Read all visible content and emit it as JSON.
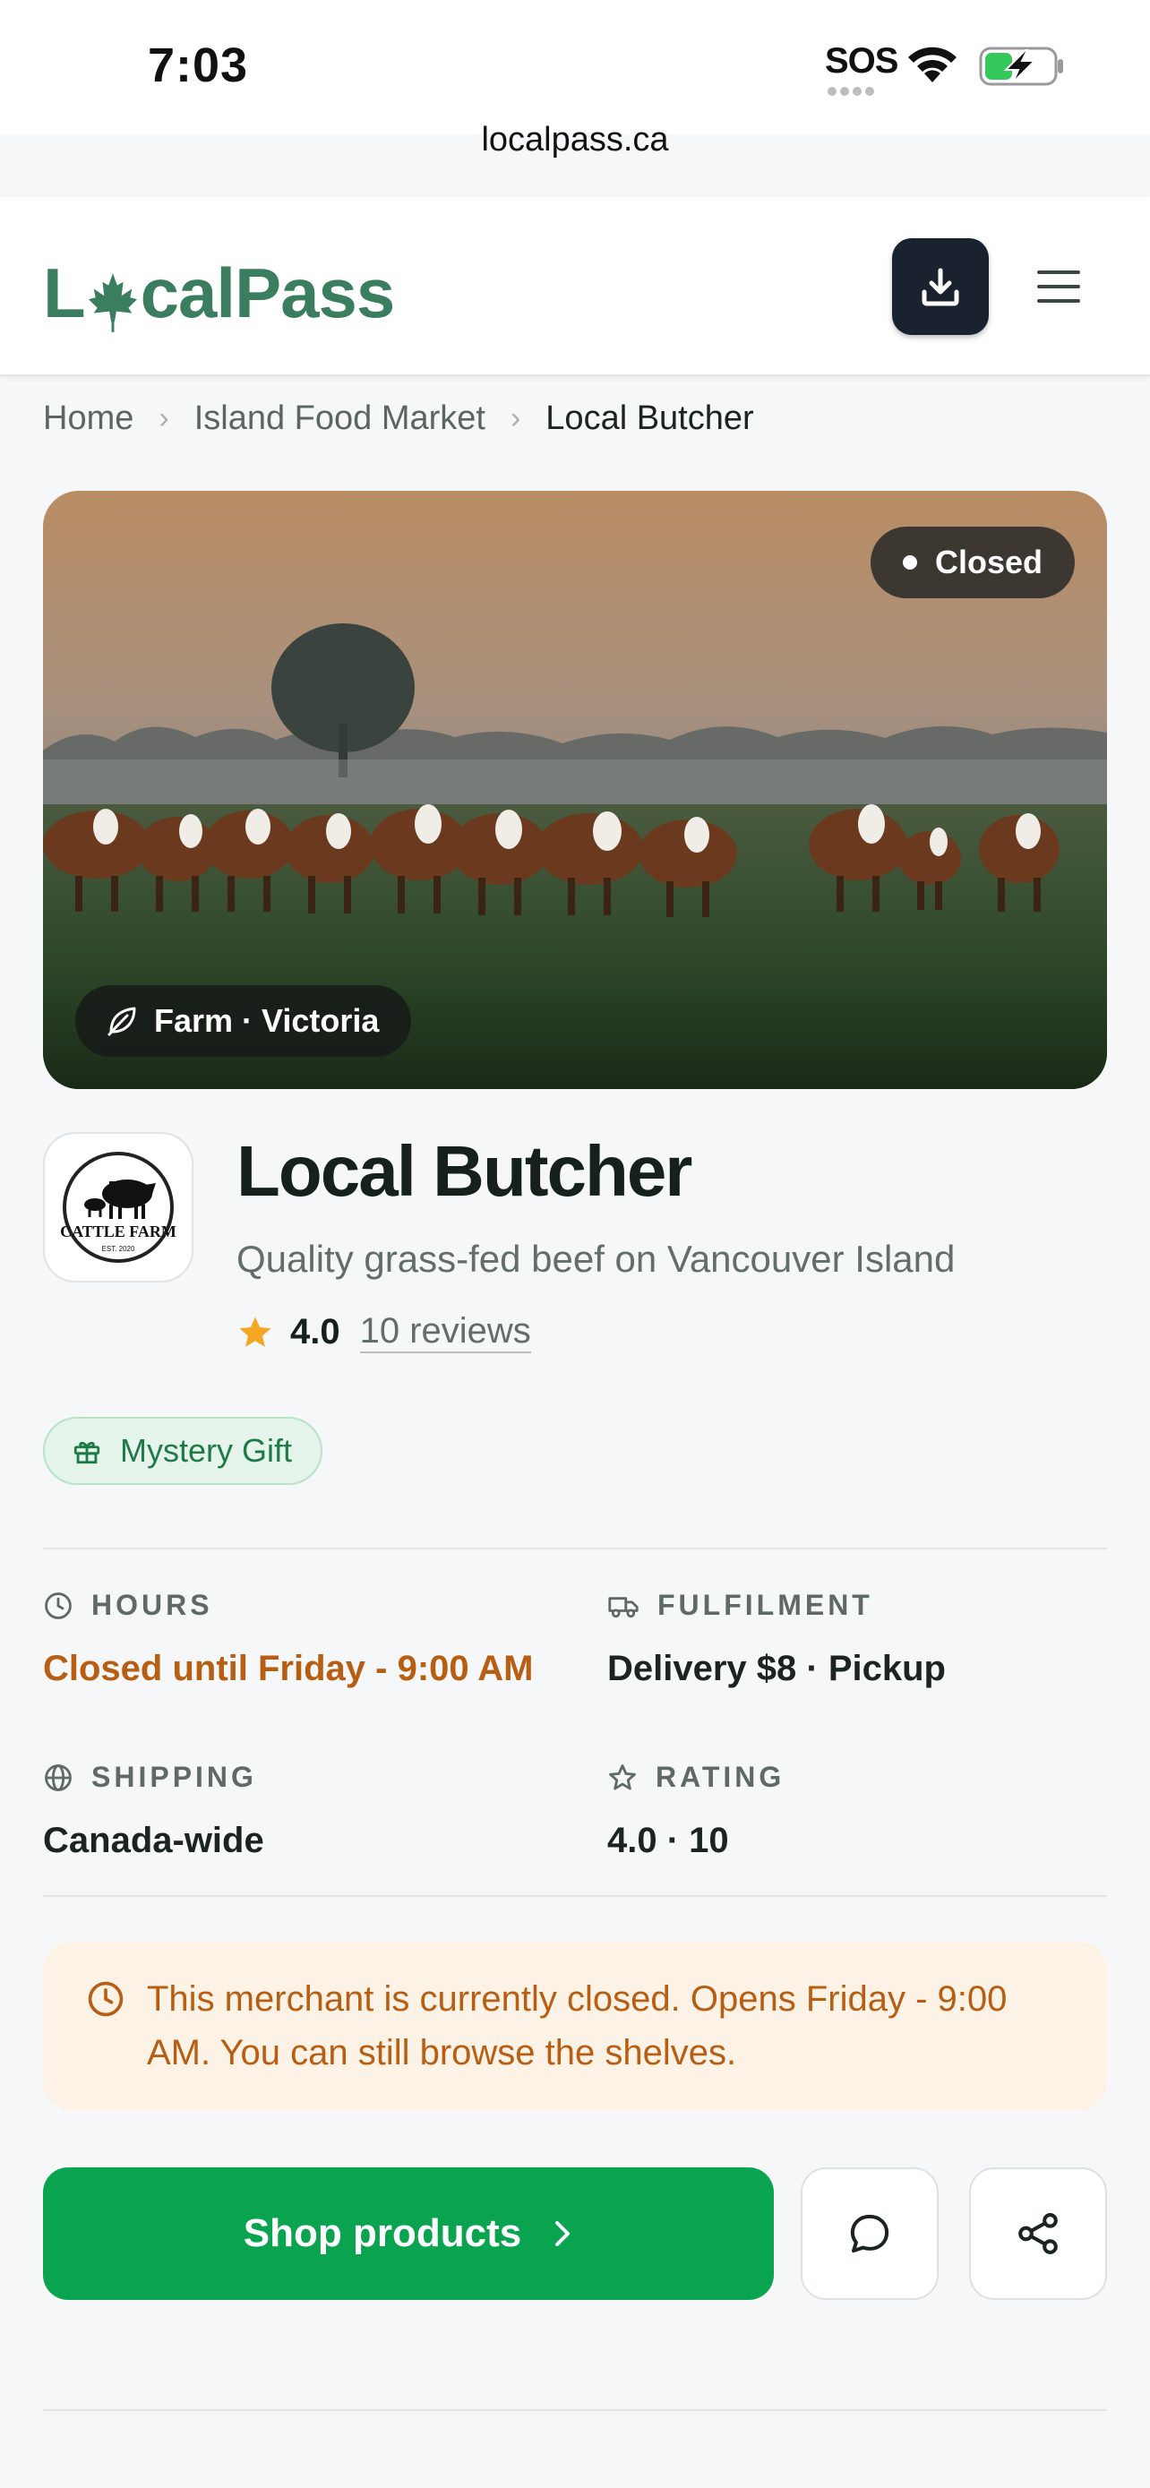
{
  "status_bar": {
    "time": "7:03",
    "sos": "SOS"
  },
  "browser": {
    "url": "localpass.ca"
  },
  "header": {
    "logo_prefix": "L",
    "logo_suffix": "calPass",
    "download_icon": "download-icon",
    "menu_icon": "hamburger-menu-icon"
  },
  "breadcrumb": {
    "items": [
      "Home",
      "Island Food Market",
      "Local Butcher"
    ]
  },
  "hero": {
    "status_badge": "Closed",
    "location_badge": "Farm · Victoria",
    "location_icon": "leaf-icon"
  },
  "merchant": {
    "logo_text": "CATTLE FARM",
    "logo_small_text": "EST. 2020",
    "name": "Local Butcher",
    "tagline": "Quality grass-fed beef on Vancouver Island",
    "rating": "4.0",
    "reviews": "10 reviews"
  },
  "promo": {
    "label": "Mystery Gift",
    "icon": "gift-icon"
  },
  "info": {
    "hours": {
      "label": "HOURS",
      "value": "Closed until Friday - 9:00 AM",
      "icon": "clock-icon"
    },
    "fulfilment": {
      "label": "FULFILMENT",
      "value": "Delivery $8 · Pickup",
      "icon": "truck-icon"
    },
    "shipping": {
      "label": "SHIPPING",
      "value": "Canada-wide",
      "icon": "globe-icon"
    },
    "rating": {
      "label": "RATING",
      "value": "4.0 · 10",
      "icon": "star-outline-icon"
    }
  },
  "notice": {
    "text": "This merchant is currently closed. Opens Friday - 9:00 AM. You can still browse the shelves."
  },
  "actions": {
    "shop_label": "Shop products",
    "message_icon": "chat-bubble-icon",
    "share_icon": "share-icon"
  },
  "colors": {
    "brand": "#3a7d5f",
    "primary_button": "#0aa34f",
    "warning": "#b85e12",
    "star": "#f5a623"
  }
}
